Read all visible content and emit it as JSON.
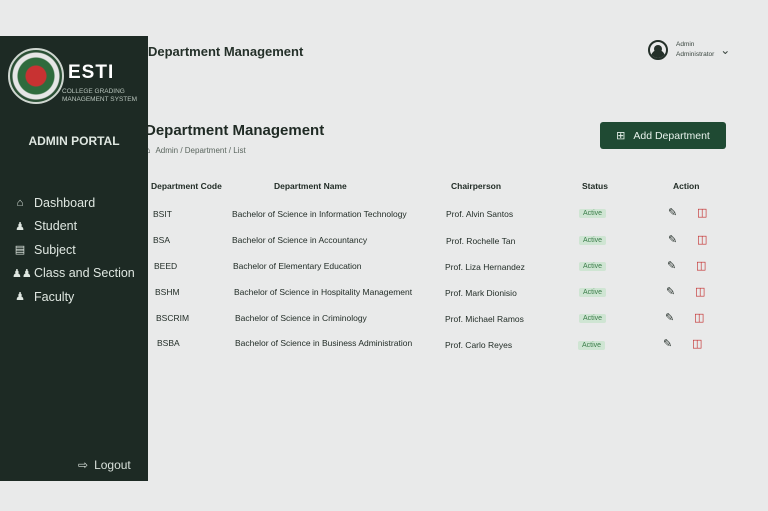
{
  "sidebar": {
    "brand_title": "ESTI",
    "brand_sub": "College Grading Management System",
    "portal": "ADMIN PORTAL",
    "items": [
      {
        "label": "Dashboard",
        "icon": "home-icon"
      },
      {
        "label": "Student",
        "icon": "student-icon"
      },
      {
        "label": "Subject",
        "icon": "book-icon"
      },
      {
        "label": "Class and Section",
        "icon": "users-icon"
      },
      {
        "label": "Faculty",
        "icon": "user-icon"
      }
    ],
    "logout": "Logout"
  },
  "topbar": {
    "title": "Department Management",
    "user_name": "Admin",
    "user_role": "Administrator"
  },
  "main": {
    "title": "Department Management",
    "breadcrumb": "Admin / Department / List",
    "add_button": "Add Department"
  },
  "table": {
    "headers": [
      "Department Code",
      "Department Name",
      "Chairperson",
      "Status",
      "Action"
    ],
    "rows": [
      {
        "code": "BSIT",
        "name": "Bachelor of Science in Information Technology",
        "chair": "Prof. Alvin Santos",
        "status": "Active"
      },
      {
        "code": "BSA",
        "name": "Bachelor of Science in Accountancy",
        "chair": "Prof. Rochelle Tan",
        "status": "Active"
      },
      {
        "code": "BEED",
        "name": "Bachelor of Elementary Education",
        "chair": "Prof. Liza Hernandez",
        "status": "Active"
      },
      {
        "code": "BSHM",
        "name": "Bachelor of Science in Hospitality Management",
        "chair": "Prof. Mark Dionisio",
        "status": "Active"
      },
      {
        "code": "BSCRIM",
        "name": "Bachelor of Science in Criminology",
        "chair": "Prof. Michael Ramos",
        "status": "Active"
      },
      {
        "code": "BSBA",
        "name": "Bachelor of Science in Business Administration",
        "chair": "Prof. Carlo Reyes",
        "status": "Active"
      }
    ]
  },
  "colors": {
    "sidebar_bg": "#1d2a24",
    "accent": "#1f4a33",
    "status_active": "#3a7d49",
    "delete": "#c22b2b"
  }
}
